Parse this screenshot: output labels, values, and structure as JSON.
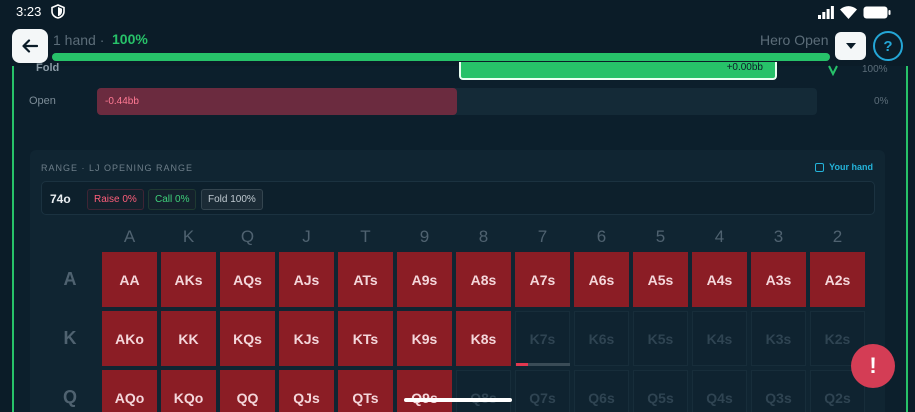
{
  "status": {
    "time": "3:23"
  },
  "header": {
    "hand_count": "1 hand",
    "separator": "·",
    "percent": "100%",
    "progress": 1.0,
    "scenario": "Hero Open",
    "help": "?"
  },
  "actions": {
    "fold": {
      "label": "Fold",
      "value": "+0.00bb",
      "percent": "100%"
    },
    "open": {
      "label": "Open",
      "value": "-0.44bb",
      "percent": "0%"
    }
  },
  "range": {
    "title": "RANGE · LJ OPENING RANGE",
    "your_hand": "Your hand",
    "hand": "74o",
    "chips": {
      "raise": "Raise 0%",
      "call": "Call 0%",
      "fold": "Fold 100%"
    },
    "columns": [
      "A",
      "K",
      "Q",
      "J",
      "T",
      "9",
      "8",
      "7",
      "6",
      "5",
      "4",
      "3",
      "2"
    ],
    "rows": [
      {
        "label": "A",
        "cells": [
          {
            "t": "AA",
            "s": "raise"
          },
          {
            "t": "AKs",
            "s": "raise"
          },
          {
            "t": "AQs",
            "s": "raise"
          },
          {
            "t": "AJs",
            "s": "raise"
          },
          {
            "t": "ATs",
            "s": "raise"
          },
          {
            "t": "A9s",
            "s": "raise"
          },
          {
            "t": "A8s",
            "s": "raise"
          },
          {
            "t": "A7s",
            "s": "raise"
          },
          {
            "t": "A6s",
            "s": "raise"
          },
          {
            "t": "A5s",
            "s": "raise"
          },
          {
            "t": "A4s",
            "s": "raise"
          },
          {
            "t": "A3s",
            "s": "raise"
          },
          {
            "t": "A2s",
            "s": "raise"
          }
        ]
      },
      {
        "label": "K",
        "cells": [
          {
            "t": "AKo",
            "s": "raise"
          },
          {
            "t": "KK",
            "s": "raise"
          },
          {
            "t": "KQs",
            "s": "raise"
          },
          {
            "t": "KJs",
            "s": "raise"
          },
          {
            "t": "KTs",
            "s": "raise"
          },
          {
            "t": "K9s",
            "s": "raise"
          },
          {
            "t": "K8s",
            "s": "raise"
          },
          {
            "t": "K7s",
            "s": "fold"
          },
          {
            "t": "K6s",
            "s": "fold"
          },
          {
            "t": "K5s",
            "s": "fold"
          },
          {
            "t": "K4s",
            "s": "fold"
          },
          {
            "t": "K3s",
            "s": "fold"
          },
          {
            "t": "K2s",
            "s": "fold"
          }
        ]
      },
      {
        "label": "Q",
        "cells": [
          {
            "t": "AQo",
            "s": "raise"
          },
          {
            "t": "KQo",
            "s": "raise"
          },
          {
            "t": "QQ",
            "s": "raise"
          },
          {
            "t": "QJs",
            "s": "raise"
          },
          {
            "t": "QTs",
            "s": "raise"
          },
          {
            "t": "Q9s",
            "s": "raise"
          },
          {
            "t": "Q8s",
            "s": "fold"
          },
          {
            "t": "Q7s",
            "s": "fold"
          },
          {
            "t": "Q6s",
            "s": "fold"
          },
          {
            "t": "Q5s",
            "s": "fold"
          },
          {
            "t": "Q4s",
            "s": "fold"
          },
          {
            "t": "Q3s",
            "s": "fold"
          },
          {
            "t": "Q2s",
            "s": "fold"
          }
        ]
      }
    ],
    "k7s_mix": 0.22
  },
  "alert": "!",
  "colors": {
    "accent": "#27c269",
    "raise": "#8b1d25",
    "info": "#24a6d6",
    "alert": "#d43d55"
  }
}
